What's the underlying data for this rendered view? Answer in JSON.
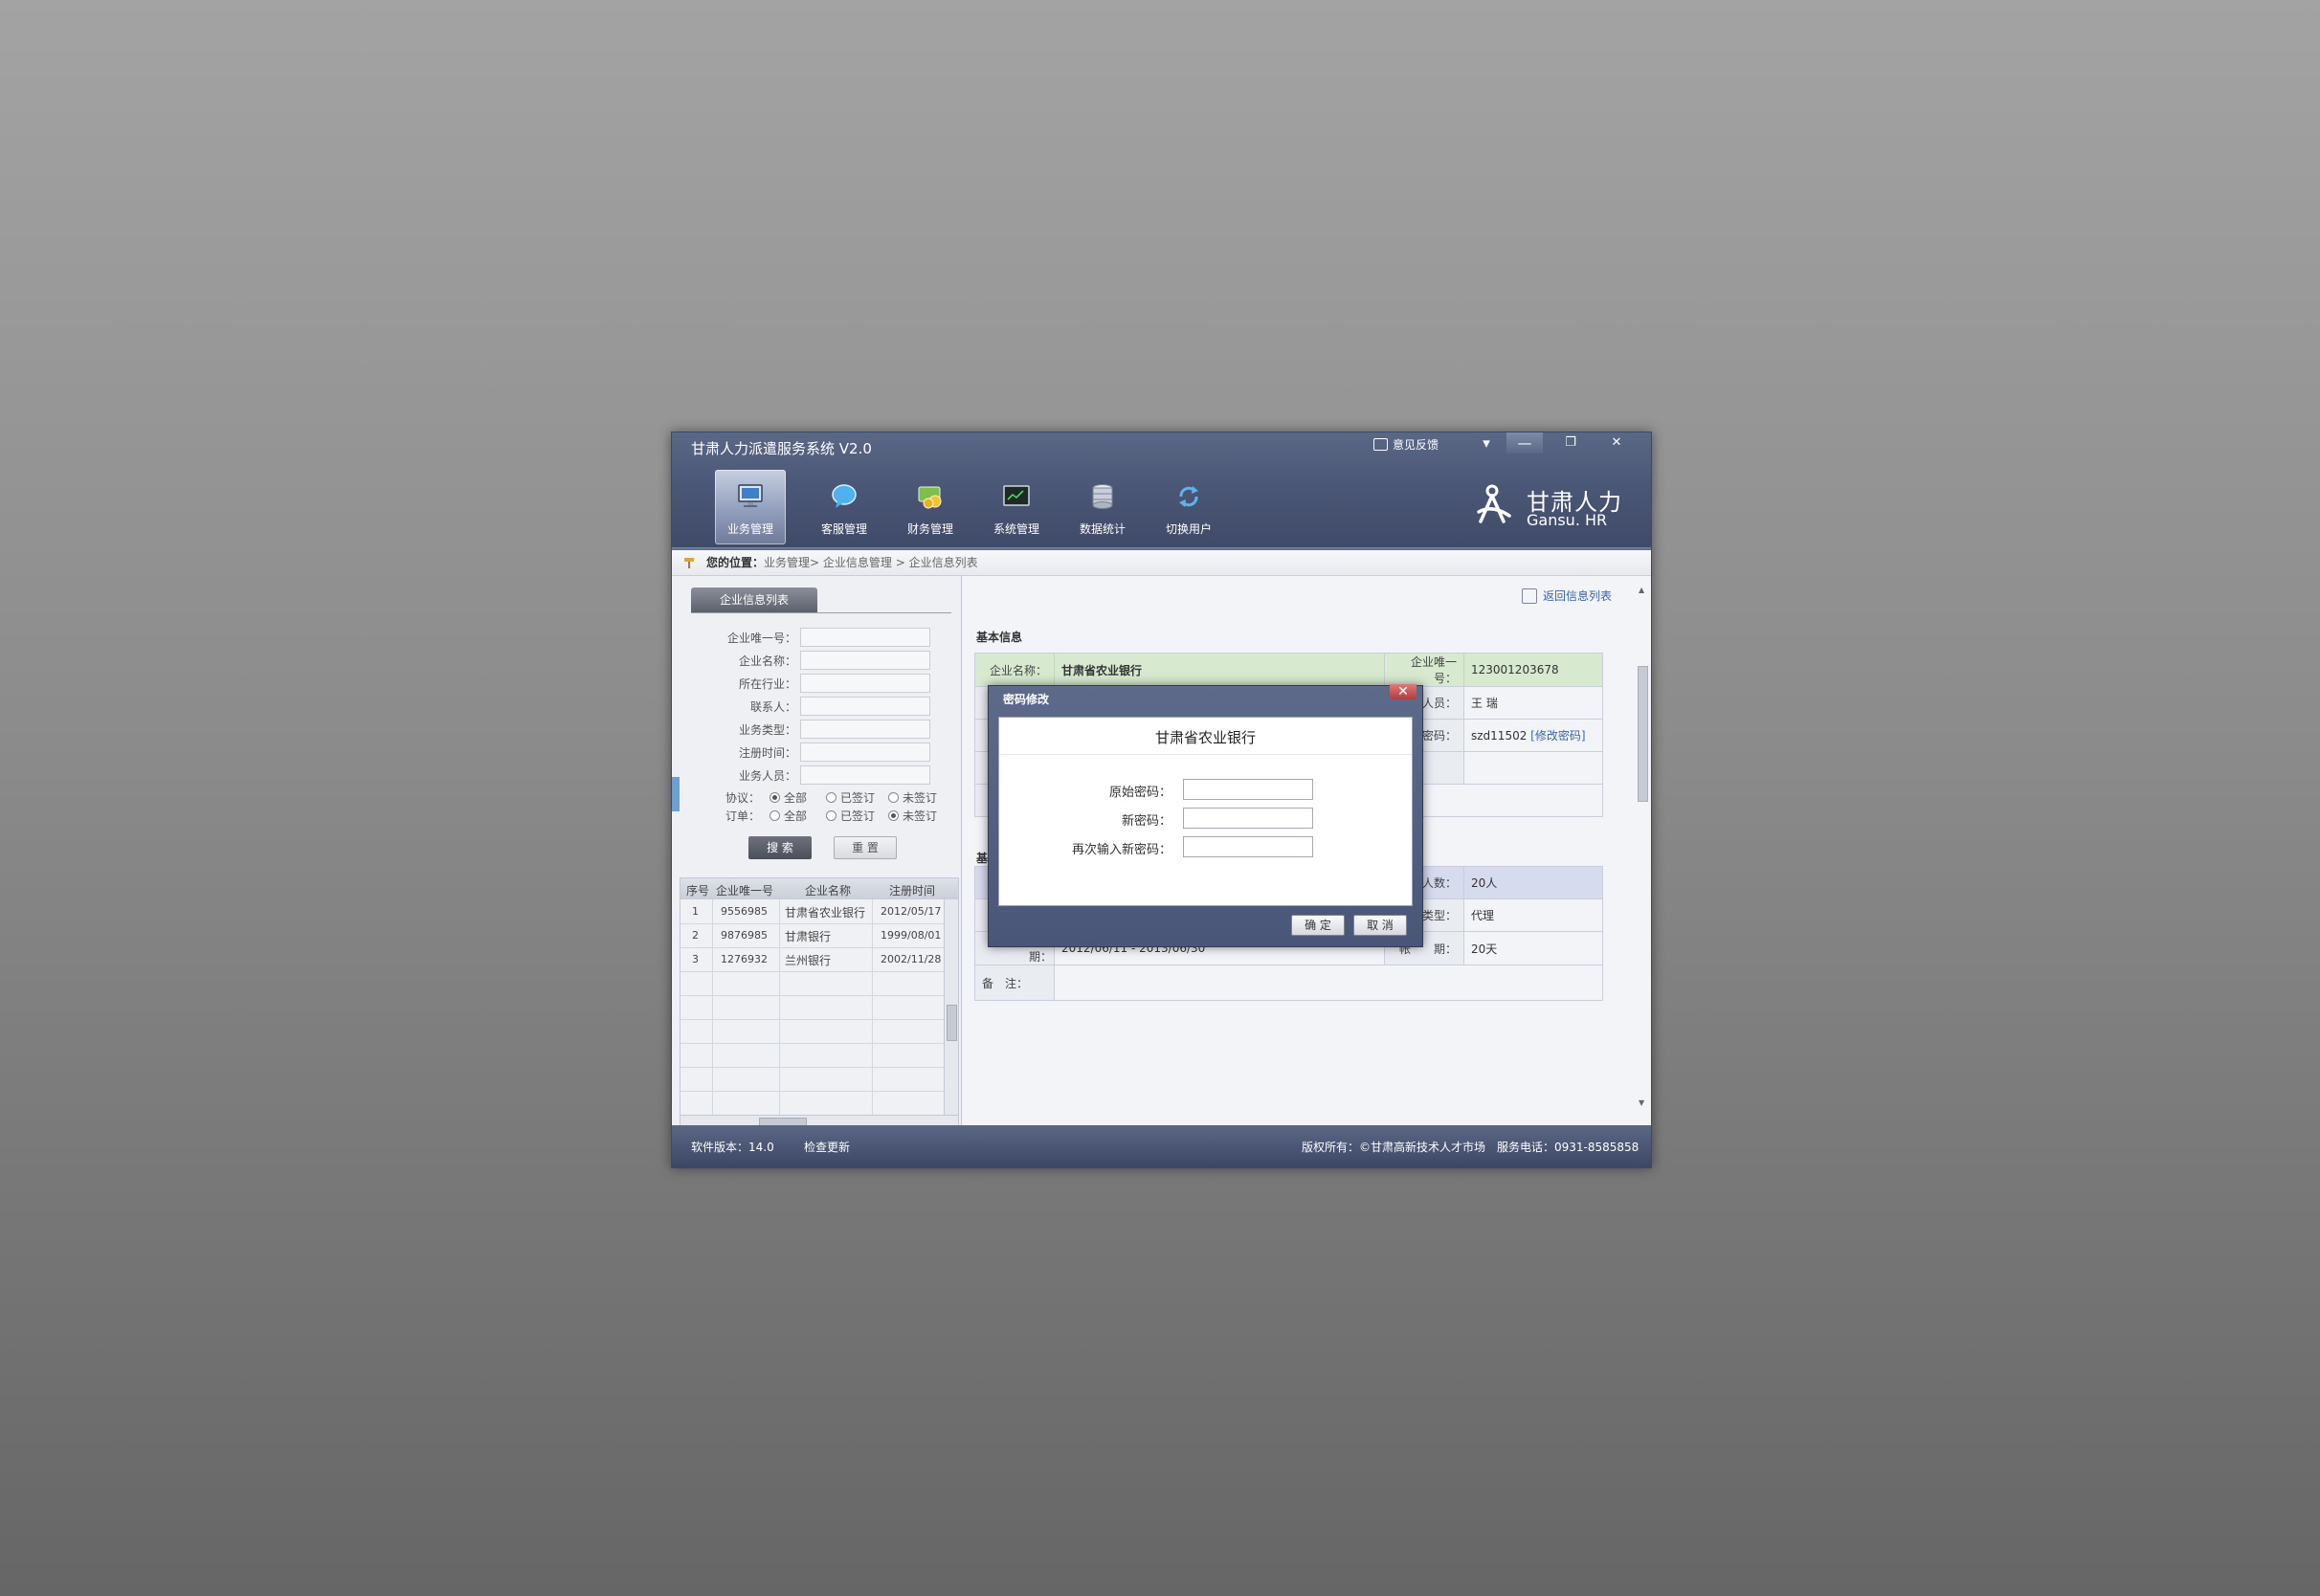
{
  "window": {
    "title": "甘肃人力派遣服务系统  V2.0",
    "feedback": "意见反馈",
    "controls": {
      "dropdown": "▾",
      "minimize": "—",
      "restore": "❐",
      "close": "✕"
    }
  },
  "nav": [
    {
      "label": "业务管理",
      "icon": "monitor-icon",
      "active": true
    },
    {
      "label": "客服管理",
      "icon": "chat-bubble-icon"
    },
    {
      "label": "财务管理",
      "icon": "coins-icon"
    },
    {
      "label": "系统管理",
      "icon": "terminal-icon"
    },
    {
      "label": "数据统计",
      "icon": "database-icon"
    },
    {
      "label": "切换用户",
      "icon": "switch-user-icon"
    }
  ],
  "logo": {
    "cn": "甘肃人力",
    "en": "Gansu. HR"
  },
  "breadcrumb": {
    "prefix": "您的位置：",
    "path": "业务管理> 企业信息管理 > 企业信息列表"
  },
  "left": {
    "tab": "企业信息列表",
    "fields": [
      {
        "label": "企业唯一号："
      },
      {
        "label": "企业名称："
      },
      {
        "label": "所在行业："
      },
      {
        "label": "联系人："
      },
      {
        "label": "业务类型："
      },
      {
        "label": "注册时间："
      },
      {
        "label": "业务人员："
      }
    ],
    "agreement": {
      "label": "协议：",
      "options": [
        "全部",
        "已签订",
        "未签订"
      ],
      "selected": "全部"
    },
    "order": {
      "label": "订单：",
      "options": [
        "全部",
        "已签订",
        "未签订"
      ],
      "selected": "未签订"
    },
    "search_btn": "搜 索",
    "reset_btn": "重 置",
    "table": {
      "headers": [
        "序号",
        "企业唯一号",
        "企业名称",
        "注册时间"
      ],
      "rows": [
        [
          "1",
          "9556985",
          "甘肃省农业银行",
          "2012/05/17"
        ],
        [
          "2",
          "9876985",
          "甘肃银行",
          "1999/08/01"
        ],
        [
          "3",
          "1276932",
          "兰州银行",
          "2002/11/28"
        ]
      ]
    }
  },
  "right": {
    "back_link": "返回信息列表",
    "section": "基本信息",
    "section2": "基",
    "basic": {
      "company_name_label": "企业名称：",
      "company_name": "甘肃省农业银行",
      "uid_label": "企业唯一号：",
      "uid": "123001203678",
      "staff_label": "务人员：",
      "staff": "王 瑞",
      "pwd_label": "业密码：",
      "pwd": "szd11502",
      "change_pwd": "[修改密码]"
    },
    "agreement": {
      "people_label": "务人数：",
      "people": "20人",
      "type_label": "务类型：",
      "type": "代理",
      "date_label": "协议起止日期：",
      "date": "2012/06/11 - 2013/06/30",
      "period_label": "帐　　期：",
      "period": "20天",
      "remark_label": "备　注："
    }
  },
  "footer": {
    "version": "软件版本：14.0",
    "update": "检查更新",
    "copyright": "版权所有：©甘肃高新技术人才市场",
    "phone": "服务电话：0931-8585858"
  },
  "dialog": {
    "title": "密码修改",
    "heading": "甘肃省农业银行",
    "old_label": "原始密码：",
    "new_label": "新密码：",
    "confirm_label": "再次输入新密码：",
    "ok": "确 定",
    "cancel": "取 消",
    "close": "✕"
  }
}
